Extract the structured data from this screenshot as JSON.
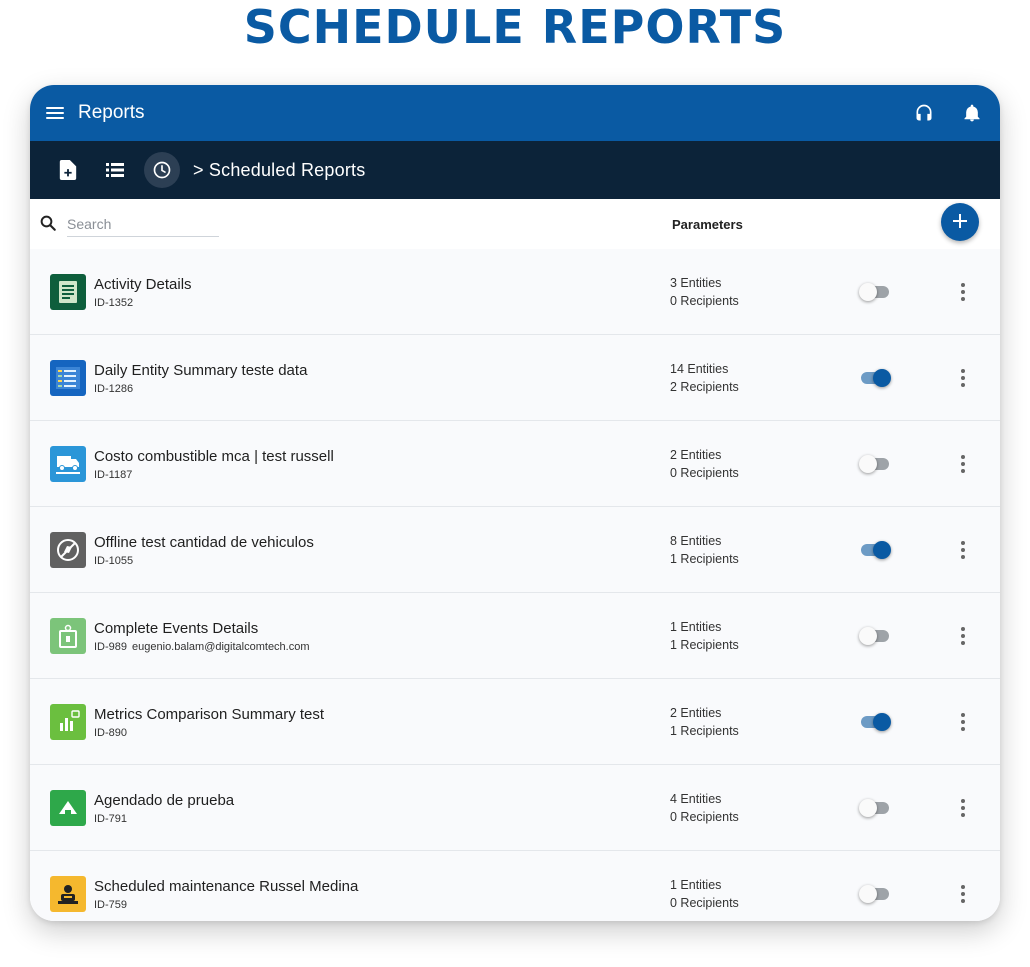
{
  "page": {
    "title": "SCHEDULE REPORTS"
  },
  "topbar": {
    "title": "Reports",
    "icons": [
      "menu-icon",
      "headset-icon",
      "bell-icon"
    ]
  },
  "subbar": {
    "breadcrumb": "> Scheduled Reports",
    "icons": [
      "new-report-icon",
      "list-icon",
      "clock-icon"
    ]
  },
  "list_header": {
    "search_placeholder": "Search",
    "parameters_label": "Parameters",
    "add_icon": "plus-icon"
  },
  "reports": [
    {
      "name": "Activity Details",
      "id": "ID-1352",
      "email": "",
      "entities": "3 Entities",
      "recipients": "0 Recipients",
      "enabled": false,
      "icon": "clipboard-icon",
      "color": "#0e5e3c"
    },
    {
      "name": "Daily Entity Summary teste data",
      "id": "ID-1286",
      "email": "",
      "entities": "14 Entities",
      "recipients": "2 Recipients",
      "enabled": true,
      "icon": "summary-list-icon",
      "color": "#1565c0"
    },
    {
      "name": "Costo combustible mca | test russell",
      "id": "ID-1187",
      "email": "",
      "entities": "2 Entities",
      "recipients": "0 Recipients",
      "enabled": false,
      "icon": "truck-icon",
      "color": "#2b96d8"
    },
    {
      "name": "Offline test cantidad de vehiculos",
      "id": "ID-1055",
      "email": "",
      "entities": "8 Entities",
      "recipients": "1 Recipients",
      "enabled": true,
      "icon": "offline-icon",
      "color": "#616161"
    },
    {
      "name": "Complete Events Details",
      "id": "ID-989",
      "email": "eugenio.balam@digitalcomtech.com",
      "entities": "1 Entities",
      "recipients": "1 Recipients",
      "enabled": false,
      "icon": "event-tag-icon",
      "color": "#7cc47a"
    },
    {
      "name": "Metrics Comparison Summary test",
      "id": "ID-890",
      "email": "",
      "entities": "2 Entities",
      "recipients": "1 Recipients",
      "enabled": true,
      "icon": "bar-chart-icon",
      "color": "#6bbf3f"
    },
    {
      "name": "Agendado de prueba",
      "id": "ID-791",
      "email": "",
      "entities": "4 Entities",
      "recipients": "0 Recipients",
      "enabled": false,
      "icon": "triangle-icon",
      "color": "#2ea84a"
    },
    {
      "name": "Scheduled maintenance Russel Medina",
      "id": "ID-759",
      "email": "",
      "entities": "1 Entities",
      "recipients": "0 Recipients",
      "enabled": false,
      "icon": "mechanic-icon",
      "color": "#f5b82e"
    }
  ]
}
